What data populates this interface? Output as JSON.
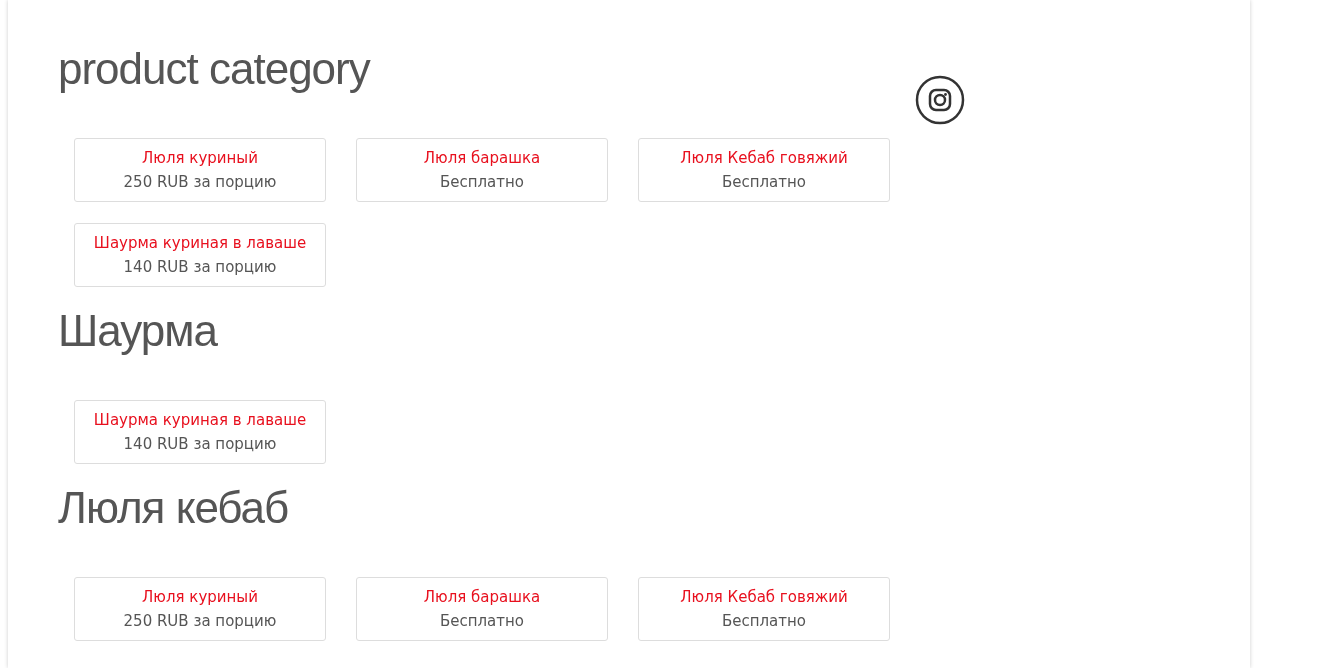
{
  "sections": [
    {
      "title": "product category",
      "products": [
        {
          "name": "Люля куриный",
          "price": "250 RUB за порцию"
        },
        {
          "name": "Люля барашка",
          "price": "Бесплатно"
        },
        {
          "name": "Люля Кебаб говяжий",
          "price": "Бесплатно"
        },
        {
          "name": "Шаурма куриная в лаваше",
          "price": "140 RUB за порцию"
        }
      ]
    },
    {
      "title": "Шаурма",
      "products": [
        {
          "name": "Шаурма куриная в лаваше",
          "price": "140 RUB за порцию"
        }
      ]
    },
    {
      "title": "Люля кебаб",
      "products": [
        {
          "name": "Люля куриный",
          "price": "250 RUB за порцию"
        },
        {
          "name": "Люля барашка",
          "price": "Бесплатно"
        },
        {
          "name": "Люля Кебаб говяжий",
          "price": "Бесплатно"
        }
      ]
    }
  ]
}
